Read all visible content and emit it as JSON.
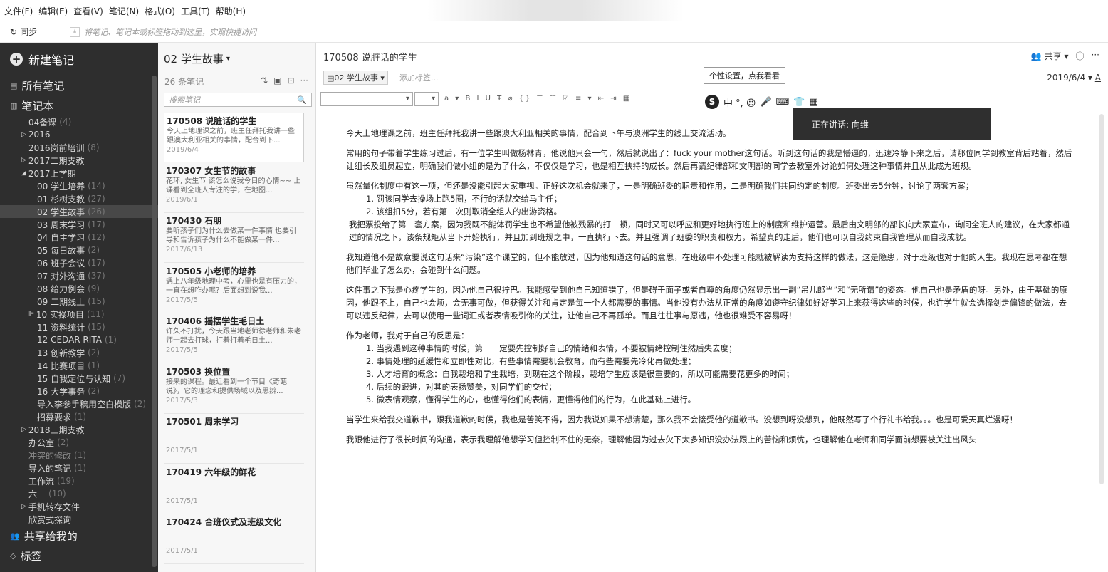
{
  "menu": [
    "文件(F)",
    "编辑(E)",
    "查看(V)",
    "笔记(N)",
    "格式(O)",
    "工具(T)",
    "帮助(H)"
  ],
  "toolbar": {
    "sync_label": "同步",
    "shortcut_hint": "将笔记、笔记本或标签拖动到这里，实现快捷访问"
  },
  "sidebar": {
    "new_note": "新建笔记",
    "all_notes": "所有笔记",
    "notebooks": "笔记本",
    "items": [
      {
        "label": "04备课",
        "count": "(4)",
        "indent": 1
      },
      {
        "label": "2016",
        "count": "",
        "indent": 0,
        "arrow": "▷"
      },
      {
        "label": "2016岗前培训",
        "count": "(8)",
        "indent": 1
      },
      {
        "label": "2017二期支教",
        "count": "",
        "indent": 0,
        "arrow": "▷"
      },
      {
        "label": "2017上学期",
        "count": "",
        "indent": 0,
        "arrow": "◢"
      },
      {
        "label": "00 学生培养",
        "count": "(14)",
        "indent": 2
      },
      {
        "label": "01 杉树支教",
        "count": "(27)",
        "indent": 2
      },
      {
        "label": "02 学生故事",
        "count": "(26)",
        "indent": 2,
        "selected": true
      },
      {
        "label": "03 周末学习",
        "count": "(17)",
        "indent": 2
      },
      {
        "label": "04 自主学习",
        "count": "(12)",
        "indent": 2
      },
      {
        "label": "05 每日故事",
        "count": "(2)",
        "indent": 2
      },
      {
        "label": "06 班子会议",
        "count": "(17)",
        "indent": 2
      },
      {
        "label": "07 对外沟通",
        "count": "(37)",
        "indent": 2
      },
      {
        "label": "08 给力例会",
        "count": "(9)",
        "indent": 2
      },
      {
        "label": "09 二期线上",
        "count": "(15)",
        "indent": 2
      },
      {
        "label": "10 实操项目",
        "count": "(11)",
        "indent": 1,
        "arrow": "⊫"
      },
      {
        "label": "11 资料统计",
        "count": "(15)",
        "indent": 2
      },
      {
        "label": "12 CEDAR RITA",
        "count": "(1)",
        "indent": 2
      },
      {
        "label": "13 创新教学",
        "count": "(2)",
        "indent": 2
      },
      {
        "label": "14 比赛项目",
        "count": "(1)",
        "indent": 2
      },
      {
        "label": "15 自我定位与认知",
        "count": "(7)",
        "indent": 2
      },
      {
        "label": "16 大学事务",
        "count": "(2)",
        "indent": 2
      },
      {
        "label": "导入李参手稿用空白模版",
        "count": "(2)",
        "indent": 2
      },
      {
        "label": "招募要求",
        "count": "(1)",
        "indent": 2
      },
      {
        "label": "2018三期支教",
        "count": "",
        "indent": 0,
        "arrow": "▷"
      },
      {
        "label": "办公室",
        "count": "(2)",
        "indent": 1
      },
      {
        "label": "冲突的修改",
        "count": "(1)",
        "indent": 1,
        "dim": true
      },
      {
        "label": "导入的笔记",
        "count": "(1)",
        "indent": 1
      },
      {
        "label": "工作流",
        "count": "(19)",
        "indent": 1
      },
      {
        "label": "六一",
        "count": "(10)",
        "indent": 1
      },
      {
        "label": "手机转存文件",
        "count": "",
        "indent": 0,
        "arrow": "▷"
      },
      {
        "label": "欣赏式探询",
        "count": "",
        "indent": 1
      }
    ],
    "shared": "共享给我的",
    "tags": "标签"
  },
  "notelist": {
    "title": "02 学生故事",
    "count": "26 条笔记",
    "search_placeholder": "搜索笔记",
    "notes": [
      {
        "title": "170508 说脏话的学生",
        "snippet": "今天上地理课之前，班主任拜托我讲一些跟澳大利亚相关的事情，配合到下...",
        "date": "2019/6/4",
        "selected": true
      },
      {
        "title": "170307 女生节的故事",
        "snippet": "花环, 女生节 该怎么说我今日的心情~~ 上课看到全班人专注的学，在地图...",
        "date": "2019/6/1"
      },
      {
        "title": "170430 石朋",
        "snippet": "要听孩子们为什么去做某一件事情 也要引导和告诉孩子为什么不能做某一件...",
        "date": "2017/6/13"
      },
      {
        "title": "170505 小老师的培养",
        "snippet": "遇上八年级地理中考，心里也是有压力的，一直在想咋办呢？后面想到说我...",
        "date": "2017/5/5"
      },
      {
        "title": "170406 摇摆学生毛日土",
        "snippet": "许久不打扰，今天跟当地老师徐老师和朱老师一起去打球，打着打着毛日土...",
        "date": "2017/5/5"
      },
      {
        "title": "170503 换位置",
        "snippet": "接来的课程。最近看到一个节目《奇葩说》，它的理念和提供场域以及思辨...",
        "date": "2017/5/3"
      },
      {
        "title": "170501 周末学习",
        "snippet": "",
        "date": "2017/5/1"
      },
      {
        "title": "170419 六年级的鲜花",
        "snippet": "",
        "date": "2017/5/1"
      },
      {
        "title": "170424 合班仪式及班级文化",
        "snippet": "",
        "date": "2017/5/1"
      }
    ]
  },
  "editor": {
    "title": "170508 说脏话的学生",
    "share": "共享",
    "notebook_tag": "02 学生故事",
    "add_tag": "添加标签...",
    "date": "2019/6/4",
    "tooltip": "个性设置，点我看看",
    "voice_status": "正在讲话: 向维",
    "ime_chars": "中 °, ☺",
    "paragraphs": [
      {
        "type": "p",
        "text": "今天上地理课之前，班主任拜托我讲一些跟澳大利亚相关的事情，配合到下午与澳洲学生的线上交流活动。"
      },
      {
        "type": "gap"
      },
      {
        "type": "p",
        "text": "常用的句子带着学生练习过后，有一位学生叫做杨林青，他说他只会一句，然后就说出了：fuck your mother这句话。听到这句话的我是懵逼的，迅速冷静下来之后，请那位同学到教室背后站着，然后让组长及组员起立，明确我们做小组的是为了什么，不仅仅是学习，也是相互扶持的成长。然后再请纪律部和文明部的同学去教室外讨论如何处理这种事情并且从此成为班规。"
      },
      {
        "type": "gap"
      },
      {
        "type": "p",
        "text": "虽然量化制度中有这一项，但还是没能引起大家重视。正好这次机会就来了，一是明确班委的职责和作用，二是明确我们共同约定的制度。班委出去5分钟，讨论了两套方案；"
      },
      {
        "type": "ol",
        "text": "1. 罚该同学去操场上跑5圈，不行的话就交给马主任；"
      },
      {
        "type": "ol",
        "text": "2. 该组扣5分，若有第二次则取消全组人的出游资格。"
      },
      {
        "type": "ind",
        "text": "我把票投给了第二套方案，因为我既不能体罚学生也不希望他被残暴的打一顿，同时又可以呼应和更好地执行班上的制度和维护运营。最后由文明部的部长向大家宣布，询问全班人的建议，在大家都通过的情况之下，该条规矩从当下开始执行，并且加到班规之中，一直执行下去。并且强调了班委的职责和权力，希望真的走后，他们也可以自我约束自我管理从而自我成就。"
      },
      {
        "type": "gap"
      },
      {
        "type": "p",
        "text": "我知道他不是故意要说这句话来“污染”这个课堂的，但不能放过，因为他知道这句话的意思，在班级中不处理可能就被解读为支持这样的做法，这是隐患，对于班级也对于他的人生。我现在思考都在想他们毕业了怎么办，会碰到什么问题。"
      },
      {
        "type": "gap"
      },
      {
        "type": "p",
        "text": "这件事之下我是心疼学生的，因为他自己很拧巴。我能感受到他自己知道错了，但是碍于面子或者自尊的角度仍然显示出一副“吊儿郎当”和“无所谓”的姿态。他自己也是矛盾的呀。另外，由于基础的原因，他跟不上，自己也会烦，会无事可做，但获得关注和肯定是每一个人都需要的事情。当他没有办法从正常的角度如遵守纪律如好好学习上来获得这些的时候，也许学生就会选择剑走偏锋的做法，去可以违反纪律，去可以使用一些词汇或者表情吸引你的关注，让他自己不再孤单。而且往往事与愿违，他也很难受不容易呀！"
      },
      {
        "type": "gap"
      },
      {
        "type": "p",
        "text": "作为老师，我对于自己的反思是："
      },
      {
        "type": "ol",
        "text": "1. 当我遇到这种事情的时候，第一一定要先控制好自己的情绪和表情，不要被情绪控制住然后失去度；"
      },
      {
        "type": "ol",
        "text": "2. 事情处理的延缓性和立即性对比，有些事情需要机会教育，而有些需要先冷化再做处理；"
      },
      {
        "type": "ol",
        "text": "3. 人才培育的概念：自我栽培和学生栽培，到现在这个阶段，栽培学生应该是很重要的，所以可能需要花更多的时间；"
      },
      {
        "type": "ol",
        "text": "4. 后续的跟进，对其的表扬赞美，对同学们的交代；"
      },
      {
        "type": "ol",
        "text": "5. 微表情观察，懂得学生的心，也懂得他们的表情，更懂得他们的行为，在此基础上进行。"
      },
      {
        "type": "gap"
      },
      {
        "type": "p",
        "text": "当学生来给我交道歉书，跟我道歉的时候，我也是苦笑不得，因为我说如果不想清楚，那么我不会接受他的道歉书。没想到呀没想到，他既然写了个行礼书给我。。。也是可爱天真烂漫呀！"
      },
      {
        "type": "gap"
      },
      {
        "type": "p",
        "text": "我跟他进行了很长时间的沟通，表示我理解他想学习但控制不住的无奈，理解他因为过去欠下太多知识没办法跟上的苦恼和烦忧，也理解他在老师和同学面前想要被关注出风头"
      }
    ]
  }
}
